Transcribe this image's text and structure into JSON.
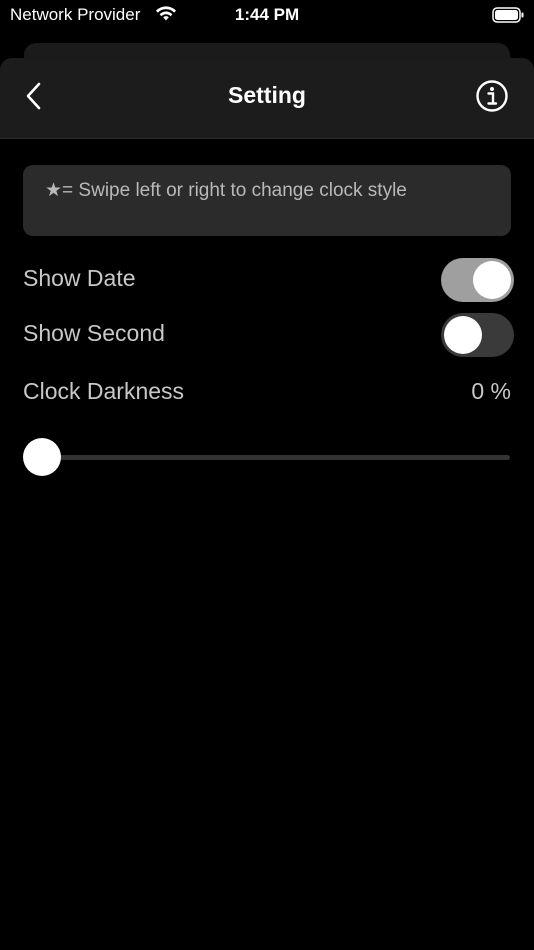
{
  "status_bar": {
    "carrier": "Network Provider",
    "time": "1:44 PM",
    "wifi_icon": "wifi-icon",
    "battery_icon": "battery-full-icon"
  },
  "nav": {
    "back_icon": "chevron-left-icon",
    "title": "Setting",
    "info_icon": "info-circle-icon"
  },
  "hint": {
    "star": "★",
    "text": "= Swipe left or right to change clock style"
  },
  "settings": {
    "show_date": {
      "label": "Show Date",
      "enabled": true
    },
    "show_second": {
      "label": "Show Second",
      "enabled": false
    },
    "clock_darkness": {
      "label": "Clock Darkness",
      "value_text": "0 %",
      "value": 0
    }
  },
  "colors": {
    "background": "#000000",
    "nav_background": "#1c1c1c",
    "hint_background": "#2b2b2b",
    "toggle_on": "#9f9f9f",
    "toggle_off": "#3a3a3a",
    "text_secondary": "#c8c8c8"
  }
}
